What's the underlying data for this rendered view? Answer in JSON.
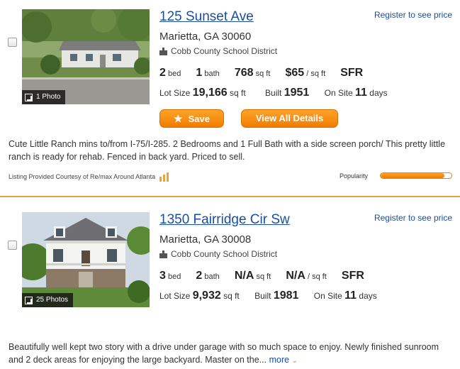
{
  "listings": [
    {
      "address": "125 Sunset Ave",
      "city": "Marietta, GA 30060",
      "school": "Cobb County School District",
      "register": "Register to see price",
      "photo_count": "1 Photo",
      "beds": "2",
      "beds_label": "bed",
      "baths": "1",
      "baths_label": "bath",
      "sqft": "768",
      "sqft_label": "sq ft",
      "price_sqft": "$65",
      "price_sqft_label": "/ sq ft",
      "type": "SFR",
      "lot_label": "Lot Size",
      "lot": "19,166",
      "lot_unit": "sq ft",
      "built_label": "Built",
      "built": "1951",
      "onsite_label": "On Site",
      "onsite": "11",
      "onsite_unit": "days",
      "save_label": "Save",
      "view_label": "View All Details",
      "description": "Cute Little Ranch mins to/from I-75/I-285. 2 Bedrooms and 1 Full Bath with a side screen porch/ This pretty little ranch is ready for rehab. Fenced in back yard. Priced to sell.",
      "courtesy": "Listing Provided Courtesy of Re/max Around Atlanta",
      "popularity_label": "Popularity",
      "popularity": 0.9
    },
    {
      "address": "1350 Fairridge Cir Sw",
      "city": "Marietta, GA 30008",
      "school": "Cobb County School District",
      "register": "Register to see price",
      "photo_count": "25 Photos",
      "beds": "3",
      "beds_label": "bed",
      "baths": "2",
      "baths_label": "bath",
      "sqft": "N/A",
      "sqft_label": "sq ft",
      "price_sqft": "N/A",
      "price_sqft_label": "/ sq ft",
      "type": "SFR",
      "lot_label": "Lot Size",
      "lot": "9,932",
      "lot_unit": "sq ft",
      "built_label": "Built",
      "built": "1981",
      "onsite_label": "On Site",
      "onsite": "11",
      "onsite_unit": "days",
      "description": "Beautifully well kept two story with a drive under garage with so much space to enjoy. Newly finished sunroom and 2 deck areas for enjoying the large backyard. Master on the...",
      "more_label": "more"
    }
  ],
  "icons": {
    "photo": "external-photo-icon",
    "school": "school-icon",
    "star": "star-icon",
    "broker": "broker-logo-icon",
    "chevron": "chevron-down-icon"
  },
  "colors": {
    "link": "#1a4fa0",
    "accent": "#f07d00",
    "divider": "#e8a33a"
  }
}
